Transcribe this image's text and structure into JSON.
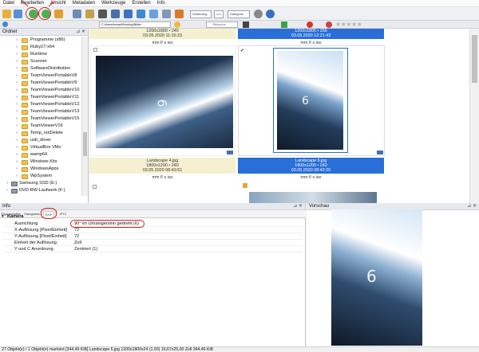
{
  "menu": [
    "Datei",
    "Bearbeiten",
    "Ansicht",
    "Metadaten",
    "Werkzeuge",
    "Erstellen",
    "Info"
  ],
  "toolbar": {
    "size_select": "Sortierung",
    "page_select": "1:1",
    "category_select": "Kategorie",
    "search_text": "Bildsuche"
  },
  "address": {
    "path": "C:\\Users\\Ismael\\Desktop\\Bilder"
  },
  "folders": {
    "title": "Ordner",
    "items": [
      "Programme (x86)",
      "Ruby27-x64",
      "Runtime",
      "Scanner",
      "SoftwareDistribution",
      "TeamViewerPortableV8",
      "TeamViewerPortableV9",
      "TeamViewerPortableV10",
      "TeamViewerPortableV11",
      "TeamViewerPortableV12",
      "TeamViewerPortableV13",
      "TeamViewerPortableV15",
      "TeamViewerV16",
      "Temp_notDelete",
      "usb_driver",
      "VirtualBox VMs",
      "wamp64",
      "Windows Kits",
      "WindowsApps",
      "WpSystem",
      "Samsung SSD (E:)",
      "DVD-RW-Laufwerk (F:)"
    ]
  },
  "thumbnails": [
    {
      "top_caption_1": "1200x1800 • 240",
      "top_caption_2": "03.05.2020 11:15:23",
      "meta": "mm f/ s iso",
      "bottom_caption_1": "Landscape 4.jpg",
      "bottom_caption_2": "1800x1200 • 240",
      "bottom_caption_3": "03.05.2020 08:43:51",
      "bottom_meta": "mm f/ s iso",
      "checked": false
    },
    {
      "top_caption_1": "1200x1800 • 256",
      "top_caption_2": "03.05.2020 12:21:43",
      "meta": "mm f/ s iso",
      "bottom_caption_1": "Landscape 6.jpg",
      "bottom_caption_2": "1800x1200 • 240",
      "bottom_caption_3": "03.05.2020 08:42:20",
      "bottom_meta": "mm f/ s iso",
      "checked": true
    }
  ],
  "info": {
    "title": "Info",
    "tabs": [
      "Eigenschaften",
      "Histogramm",
      "EXIF",
      "IPTC"
    ],
    "active_tab": "EXIF",
    "section": "Kamera",
    "rows": [
      {
        "key": "Ausrichtung",
        "value": "90° im Uhrzeigersinn gedreht (6)"
      },
      {
        "key": "X-Auflösung [Pixel/Einheit]",
        "value": "72"
      },
      {
        "key": "Y-Auflösung [Pixel/Einheit]",
        "value": "72"
      },
      {
        "key": "Einheit der Auflösung",
        "value": "Zoll"
      },
      {
        "key": "Y und C Anordnung",
        "value": "Zentriert (1)"
      }
    ]
  },
  "preview": {
    "title": "Vorschau"
  },
  "status": "27 Objekt(e) / 1 Objekt(e) markiert [344,46 KiB]   Landscape 6.jpg   1200x1800x24 (1.50)   16,67x25,00 Zoll   344,46 KiB",
  "colors": {
    "accent": "#d21e1e",
    "selection": "#2a6ed8",
    "caption_band": "#f5f0cf"
  }
}
